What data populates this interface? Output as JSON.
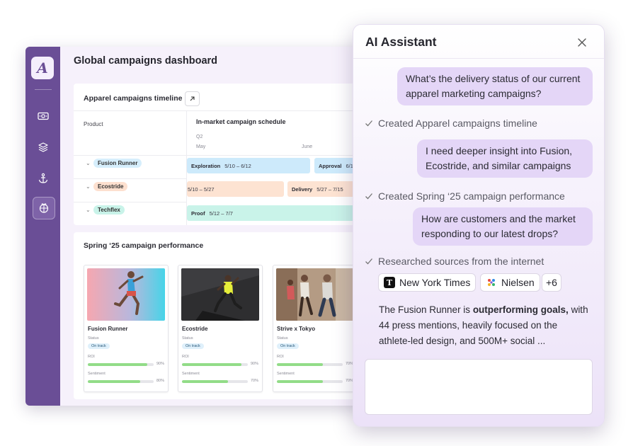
{
  "dashboard": {
    "title": "Global campaigns dashboard",
    "timeline": {
      "title": "Apparel campaigns timeline",
      "product_col": "Product",
      "schedule_title": "In-market campaign schedule",
      "quarter": "Q2",
      "months": [
        "May",
        "June"
      ],
      "rows": [
        {
          "product": "Fusion Runner",
          "bars": [
            {
              "name": "Exploration",
              "dates": "5/10 – 6/12"
            },
            {
              "name": "Approval",
              "dates": "6/1"
            }
          ]
        },
        {
          "product": "Ecostride",
          "bars": [
            {
              "name": "",
              "dates": "5/10 – 5/27"
            },
            {
              "name": "Delivery",
              "dates": "5/27 – 7/15"
            }
          ]
        },
        {
          "product": "Techflex",
          "bars": [
            {
              "name": "Proof",
              "dates": "5/12 – 7/7"
            }
          ]
        }
      ]
    },
    "performance": {
      "title": "Spring ‘25 campaign performance",
      "cards": [
        {
          "name": "Fusion Runner",
          "status_label": "Status",
          "status": "On track",
          "roi_label": "ROI",
          "roi": "90%",
          "roi_value": 0.9,
          "sentiment_label": "Sentiment",
          "sentiment": "80%",
          "sentiment_value": 0.8
        },
        {
          "name": "Ecostride",
          "status_label": "Status",
          "status": "On track",
          "roi_label": "ROI",
          "roi": "90%",
          "roi_value": 0.9,
          "sentiment_label": "Sentiment",
          "sentiment": "70%",
          "sentiment_value": 0.7
        },
        {
          "name": "Strive x Tokyo",
          "status_label": "Status",
          "status": "On track",
          "roi_label": "ROI",
          "roi": "70%",
          "roi_value": 0.7,
          "sentiment_label": "Sentiment",
          "sentiment": "70%",
          "sentiment_value": 0.7
        }
      ]
    },
    "sidebar_icons": [
      "logo-icon",
      "money-icon",
      "layers-icon",
      "anchor-icon",
      "gift-icon"
    ]
  },
  "assistant": {
    "title": "AI Assistant",
    "messages": [
      {
        "type": "user",
        "text": "What’s the delivery status of our current apparel marketing campaigns?"
      },
      {
        "type": "step",
        "text": "Created Apparel campaigns timeline"
      },
      {
        "type": "user",
        "text": "I need deeper insight into Fusion, Ecostride, and similar campaigns"
      },
      {
        "type": "step",
        "text": "Created Spring ‘25 campaign performance"
      },
      {
        "type": "user",
        "text": "How are customers and the market responding to our latest drops?"
      },
      {
        "type": "step",
        "text": "Researched sources from the internet"
      }
    ],
    "sources": [
      "New York Times",
      "Nielsen",
      "+6"
    ],
    "answer": {
      "prefix": "The Fusion Runner is ",
      "bold": "outperforming goals,",
      "suffix": " with 44 press mentions, heavily focused on the athlete-led design, and 500M+ social ..."
    },
    "input_value": ""
  },
  "colors": {
    "rail": "#6a4e96",
    "user_bubble": "#e4d6f7",
    "progress": "#92dc88",
    "fusion_pill": "#d6eefc",
    "ecostride_pill": "#fde0cf",
    "techflex_pill": "#c9f3e9"
  }
}
